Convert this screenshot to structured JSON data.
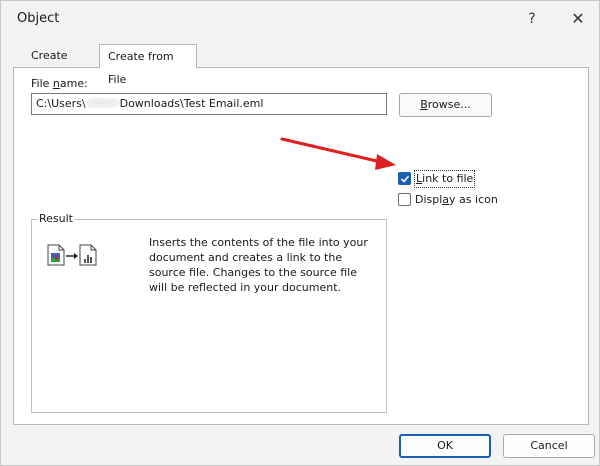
{
  "dialog": {
    "title": "Object",
    "help_glyph": "?",
    "close_glyph": "✕"
  },
  "tabs": [
    {
      "label": "Create New"
    },
    {
      "label": "Create from File"
    }
  ],
  "file": {
    "label_prefix": "File ",
    "label_underlined": "n",
    "label_suffix": "ame:",
    "path_before": "C:\\Users\\",
    "path_after": "Downloads\\Test Email.eml"
  },
  "browse": {
    "underlined": "B",
    "rest": "rowse..."
  },
  "options": {
    "link_underlined": "L",
    "link_rest": "ink to file",
    "link_checked": true,
    "display_prefix": "Displ",
    "display_underlined": "a",
    "display_suffix": "y as icon",
    "display_checked": false
  },
  "result": {
    "legend": "Result",
    "description": "Inserts the contents of the file into your document and creates a link to the source file. Changes to the source file will be reflected in your document."
  },
  "buttons": {
    "ok": "OK",
    "cancel": "Cancel"
  },
  "colors": {
    "accent": "#1a5fb4",
    "arrow": "#e02020"
  }
}
